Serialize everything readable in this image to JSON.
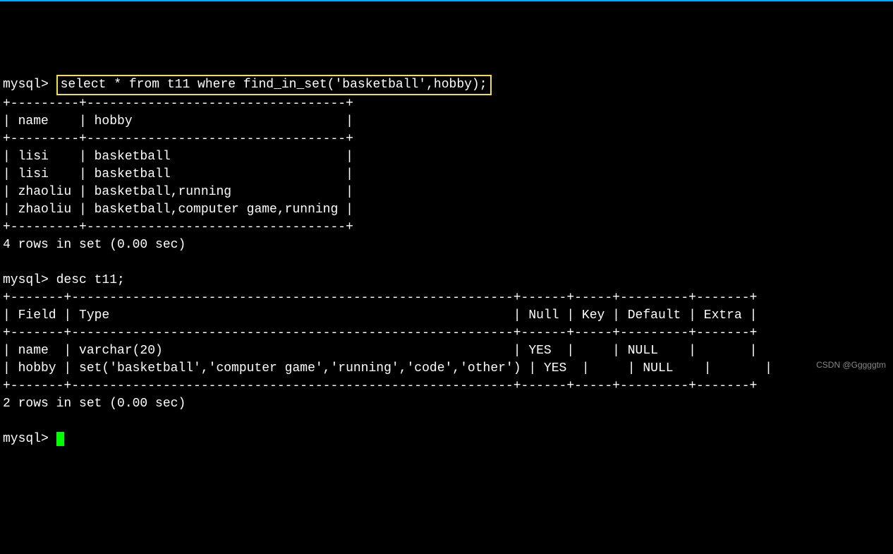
{
  "prompt": "mysql>",
  "query1": {
    "sql": "select * from t11 where find_in_set('basketball',hobby);",
    "table": {
      "border_top": "+---------+----------------------------------+",
      "header": "| name    | hobby                            |",
      "border_mid": "+---------+----------------------------------+",
      "rows": [
        "| lisi    | basketball                       |",
        "| lisi    | basketball                       |",
        "| zhaoliu | basketball,running               |",
        "| zhaoliu | basketball,computer game,running |"
      ],
      "border_bot": "+---------+----------------------------------+"
    },
    "status": "4 rows in set (0.00 sec)"
  },
  "query2": {
    "sql": "desc t11;",
    "table": {
      "border_top": "+-------+----------------------------------------------------------+------+-----+---------+-------+",
      "header": "| Field | Type                                                     | Null | Key | Default | Extra |",
      "border_mid": "+-------+----------------------------------------------------------+------+-----+---------+-------+",
      "rows": [
        "| name  | varchar(20)                                              | YES  |     | NULL    |       |",
        "| hobby | set('basketball','computer game','running','code','other') | YES  |     | NULL    |       |"
      ],
      "border_bot": "+-------+----------------------------------------------------------+------+-----+---------+-------+"
    },
    "status": "2 rows in set (0.00 sec)"
  },
  "watermark": "CSDN @Gggggtm"
}
